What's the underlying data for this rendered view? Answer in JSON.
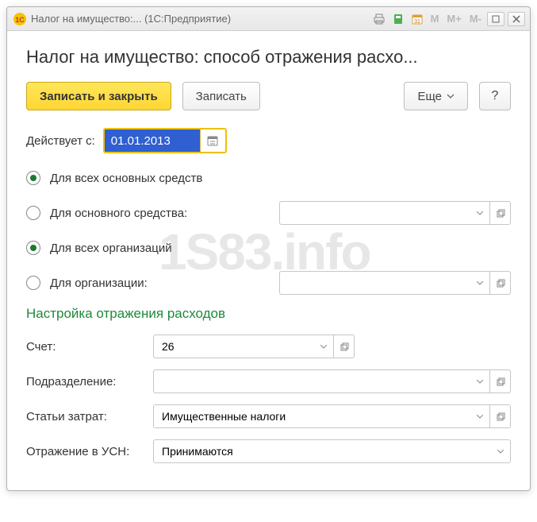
{
  "titlebar": {
    "app_icon": "1C",
    "title": "Налог на имущество:...  (1С:Предприятие)",
    "m1": "M",
    "m2": "M+",
    "m3": "M-"
  },
  "page": {
    "title": "Налог на имущество: способ отражения расхо..."
  },
  "toolbar": {
    "save_close": "Записать и закрыть",
    "save": "Записать",
    "more": "Еще",
    "help": "?"
  },
  "date": {
    "label": "Действует с:",
    "value": "01.01.2013"
  },
  "radios": {
    "all_assets": "Для всех основных средств",
    "one_asset": "Для основного средства:",
    "all_orgs": "Для всех организаций",
    "one_org": "Для организации:"
  },
  "section": {
    "title": "Настройка отражения расходов"
  },
  "fields": {
    "account_label": "Счет:",
    "account_value": "26",
    "division_label": "Подразделение:",
    "division_value": "",
    "cost_label": "Статьи затрат:",
    "cost_value": "Имущественные налоги",
    "usn_label": "Отражение в УСН:",
    "usn_value": "Принимаются"
  },
  "watermark": "1S83.info"
}
